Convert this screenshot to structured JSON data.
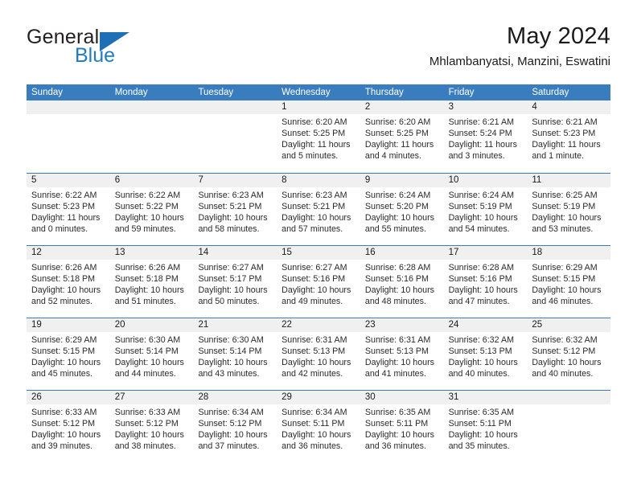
{
  "brand": {
    "line1": "General",
    "line2": "Blue",
    "accent_color": "#1e7bc4"
  },
  "header": {
    "title": "May 2024",
    "subtitle": "Mhlambanyatsi, Manzini, Eswatini"
  },
  "calendar": {
    "header_color": "#3a7dbf",
    "weekdays": [
      "Sunday",
      "Monday",
      "Tuesday",
      "Wednesday",
      "Thursday",
      "Friday",
      "Saturday"
    ],
    "weeks": [
      [
        {
          "day": "",
          "empty": true
        },
        {
          "day": "",
          "empty": true
        },
        {
          "day": "",
          "empty": true
        },
        {
          "day": "1",
          "sunrise": "Sunrise: 6:20 AM",
          "sunset": "Sunset: 5:25 PM",
          "daylight": "Daylight: 11 hours and 5 minutes."
        },
        {
          "day": "2",
          "sunrise": "Sunrise: 6:20 AM",
          "sunset": "Sunset: 5:25 PM",
          "daylight": "Daylight: 11 hours and 4 minutes."
        },
        {
          "day": "3",
          "sunrise": "Sunrise: 6:21 AM",
          "sunset": "Sunset: 5:24 PM",
          "daylight": "Daylight: 11 hours and 3 minutes."
        },
        {
          "day": "4",
          "sunrise": "Sunrise: 6:21 AM",
          "sunset": "Sunset: 5:23 PM",
          "daylight": "Daylight: 11 hours and 1 minute."
        }
      ],
      [
        {
          "day": "5",
          "sunrise": "Sunrise: 6:22 AM",
          "sunset": "Sunset: 5:23 PM",
          "daylight": "Daylight: 11 hours and 0 minutes."
        },
        {
          "day": "6",
          "sunrise": "Sunrise: 6:22 AM",
          "sunset": "Sunset: 5:22 PM",
          "daylight": "Daylight: 10 hours and 59 minutes."
        },
        {
          "day": "7",
          "sunrise": "Sunrise: 6:23 AM",
          "sunset": "Sunset: 5:21 PM",
          "daylight": "Daylight: 10 hours and 58 minutes."
        },
        {
          "day": "8",
          "sunrise": "Sunrise: 6:23 AM",
          "sunset": "Sunset: 5:21 PM",
          "daylight": "Daylight: 10 hours and 57 minutes."
        },
        {
          "day": "9",
          "sunrise": "Sunrise: 6:24 AM",
          "sunset": "Sunset: 5:20 PM",
          "daylight": "Daylight: 10 hours and 55 minutes."
        },
        {
          "day": "10",
          "sunrise": "Sunrise: 6:24 AM",
          "sunset": "Sunset: 5:19 PM",
          "daylight": "Daylight: 10 hours and 54 minutes."
        },
        {
          "day": "11",
          "sunrise": "Sunrise: 6:25 AM",
          "sunset": "Sunset: 5:19 PM",
          "daylight": "Daylight: 10 hours and 53 minutes."
        }
      ],
      [
        {
          "day": "12",
          "sunrise": "Sunrise: 6:26 AM",
          "sunset": "Sunset: 5:18 PM",
          "daylight": "Daylight: 10 hours and 52 minutes."
        },
        {
          "day": "13",
          "sunrise": "Sunrise: 6:26 AM",
          "sunset": "Sunset: 5:18 PM",
          "daylight": "Daylight: 10 hours and 51 minutes."
        },
        {
          "day": "14",
          "sunrise": "Sunrise: 6:27 AM",
          "sunset": "Sunset: 5:17 PM",
          "daylight": "Daylight: 10 hours and 50 minutes."
        },
        {
          "day": "15",
          "sunrise": "Sunrise: 6:27 AM",
          "sunset": "Sunset: 5:16 PM",
          "daylight": "Daylight: 10 hours and 49 minutes."
        },
        {
          "day": "16",
          "sunrise": "Sunrise: 6:28 AM",
          "sunset": "Sunset: 5:16 PM",
          "daylight": "Daylight: 10 hours and 48 minutes."
        },
        {
          "day": "17",
          "sunrise": "Sunrise: 6:28 AM",
          "sunset": "Sunset: 5:16 PM",
          "daylight": "Daylight: 10 hours and 47 minutes."
        },
        {
          "day": "18",
          "sunrise": "Sunrise: 6:29 AM",
          "sunset": "Sunset: 5:15 PM",
          "daylight": "Daylight: 10 hours and 46 minutes."
        }
      ],
      [
        {
          "day": "19",
          "sunrise": "Sunrise: 6:29 AM",
          "sunset": "Sunset: 5:15 PM",
          "daylight": "Daylight: 10 hours and 45 minutes."
        },
        {
          "day": "20",
          "sunrise": "Sunrise: 6:30 AM",
          "sunset": "Sunset: 5:14 PM",
          "daylight": "Daylight: 10 hours and 44 minutes."
        },
        {
          "day": "21",
          "sunrise": "Sunrise: 6:30 AM",
          "sunset": "Sunset: 5:14 PM",
          "daylight": "Daylight: 10 hours and 43 minutes."
        },
        {
          "day": "22",
          "sunrise": "Sunrise: 6:31 AM",
          "sunset": "Sunset: 5:13 PM",
          "daylight": "Daylight: 10 hours and 42 minutes."
        },
        {
          "day": "23",
          "sunrise": "Sunrise: 6:31 AM",
          "sunset": "Sunset: 5:13 PM",
          "daylight": "Daylight: 10 hours and 41 minutes."
        },
        {
          "day": "24",
          "sunrise": "Sunrise: 6:32 AM",
          "sunset": "Sunset: 5:13 PM",
          "daylight": "Daylight: 10 hours and 40 minutes."
        },
        {
          "day": "25",
          "sunrise": "Sunrise: 6:32 AM",
          "sunset": "Sunset: 5:12 PM",
          "daylight": "Daylight: 10 hours and 40 minutes."
        }
      ],
      [
        {
          "day": "26",
          "sunrise": "Sunrise: 6:33 AM",
          "sunset": "Sunset: 5:12 PM",
          "daylight": "Daylight: 10 hours and 39 minutes."
        },
        {
          "day": "27",
          "sunrise": "Sunrise: 6:33 AM",
          "sunset": "Sunset: 5:12 PM",
          "daylight": "Daylight: 10 hours and 38 minutes."
        },
        {
          "day": "28",
          "sunrise": "Sunrise: 6:34 AM",
          "sunset": "Sunset: 5:12 PM",
          "daylight": "Daylight: 10 hours and 37 minutes."
        },
        {
          "day": "29",
          "sunrise": "Sunrise: 6:34 AM",
          "sunset": "Sunset: 5:11 PM",
          "daylight": "Daylight: 10 hours and 36 minutes."
        },
        {
          "day": "30",
          "sunrise": "Sunrise: 6:35 AM",
          "sunset": "Sunset: 5:11 PM",
          "daylight": "Daylight: 10 hours and 36 minutes."
        },
        {
          "day": "31",
          "sunrise": "Sunrise: 6:35 AM",
          "sunset": "Sunset: 5:11 PM",
          "daylight": "Daylight: 10 hours and 35 minutes."
        },
        {
          "day": "",
          "empty": true
        }
      ]
    ]
  }
}
